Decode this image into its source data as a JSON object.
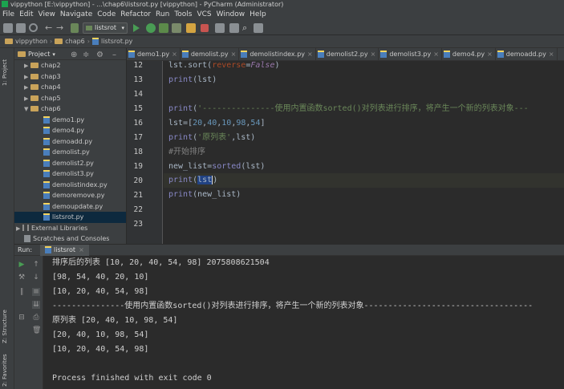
{
  "window": {
    "title": "vippython [E:\\vippython] - ...\\chap6\\listsrot.py [vippython] - PyCharm (Administrator)"
  },
  "menu": [
    "File",
    "Edit",
    "View",
    "Navigate",
    "Code",
    "Refactor",
    "Run",
    "Tools",
    "VCS",
    "Window",
    "Help"
  ],
  "toolbar": {
    "run_config": "listsrot"
  },
  "breadcrumb": [
    "vippython",
    "chap6",
    "listsrot.py"
  ],
  "side_tabs": {
    "project": "1: Project",
    "structure": "Z: Structure",
    "favorites": "2: Favorites"
  },
  "project": {
    "header": "Project",
    "folders": [
      "chap2",
      "chap3",
      "chap4",
      "chap5",
      "chap6"
    ],
    "files": [
      "demo1.py",
      "demo4.py",
      "demoadd.py",
      "demolist.py",
      "demolist2.py",
      "demolist3.py",
      "demolistindex.py",
      "demoremove.py",
      "demoupdate.py",
      "listsrot.py"
    ],
    "external_libraries": "External Libraries",
    "scratches": "Scratches and Consoles"
  },
  "editor": {
    "tabs": [
      "demo1.py",
      "demolist.py",
      "demolistindex.py",
      "demolist2.py",
      "demolist3.py",
      "demo4.py",
      "demoadd.py"
    ],
    "line_numbers": [
      "12",
      "13",
      "14",
      "15",
      "16",
      "17",
      "18",
      "19",
      "20",
      "21",
      "22",
      "23"
    ],
    "code": {
      "l12": "lst.sort(reverse=False)",
      "l13": "print(lst)",
      "l15": "print('---------------使用内置函数sorted()对列表进行排序，将产生一个新的列表对象---",
      "l16": "lst=[20,40,10,98,54]",
      "l17": "print('原列表',lst)",
      "l18": "#开始排序",
      "l19": "new_list=sorted(lst)",
      "l20": "print(lst)",
      "l21": "print(new_list)"
    }
  },
  "run": {
    "header": "Run:",
    "tab": "listsrot",
    "output": [
      "排序后的列表 [10, 20, 40, 54, 98] 2075808621504",
      "[98, 54, 40, 20, 10]",
      "[10, 20, 40, 54, 98]",
      "---------------使用内置函数sorted()对列表进行排序，将产生一个新的列表对象-----------------------------------",
      "原列表 [20, 40, 10, 98, 54]",
      "[20, 40, 10, 98, 54]",
      "[10, 20, 40, 54, 98]",
      "",
      "Process finished with exit code 0"
    ]
  },
  "colors": {
    "background": "#2b2b2b",
    "panel": "#3c3f41",
    "keyword": "#cc7832",
    "string": "#6a8759",
    "number": "#6897bb",
    "builtin": "#8888c6",
    "comment": "#808080"
  }
}
